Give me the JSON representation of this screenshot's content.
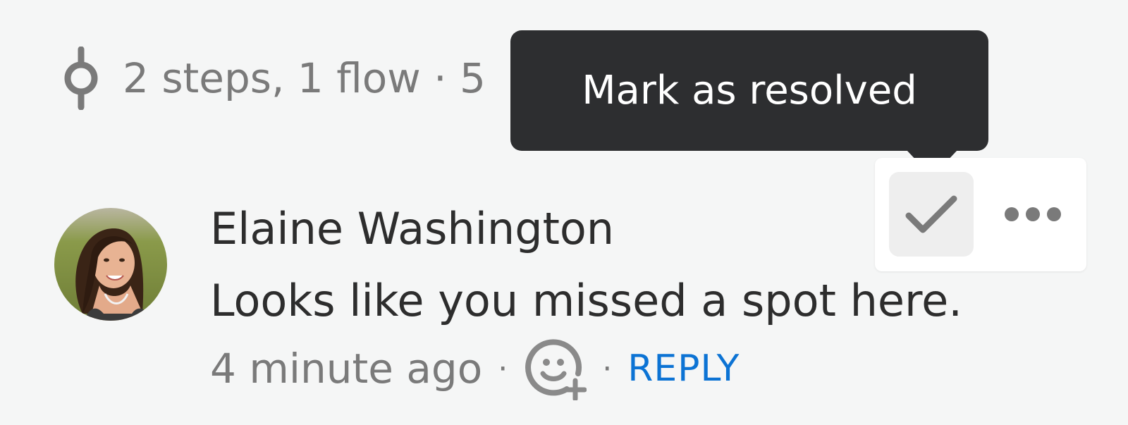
{
  "header": {
    "flow_summary": "2 steps, 1 flow · 5",
    "flow_icon": "flow-steps-icon"
  },
  "tooltip": {
    "text": "Mark as resolved"
  },
  "actions": {
    "resolve_icon": "checkmark-icon",
    "more_icon": "more-horizontal-icon"
  },
  "comment": {
    "author": "Elaine Washington",
    "body": "Looks like you missed a spot here.",
    "timestamp": "4 minute ago",
    "separator": "·",
    "reaction_icon": "add-reaction-icon",
    "reply_label": "REPLY"
  },
  "colors": {
    "background": "#f5f6f6",
    "tooltip_bg": "#2d2e30",
    "link": "#0c73d4",
    "muted_text": "#7a7a7a",
    "primary_text": "#2d2d2d"
  }
}
